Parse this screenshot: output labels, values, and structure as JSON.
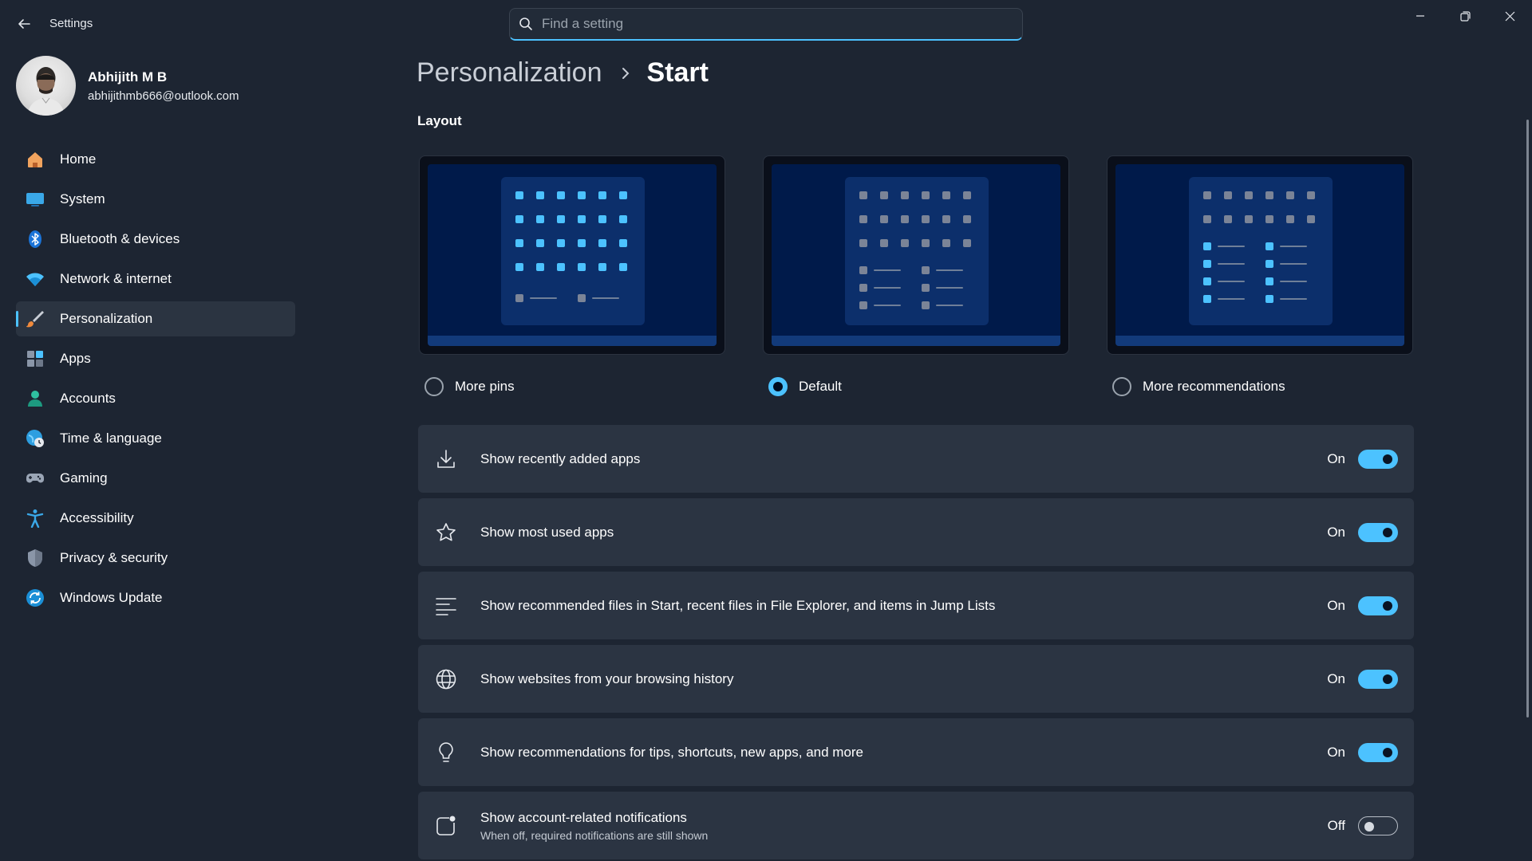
{
  "app": {
    "title": "Settings"
  },
  "search": {
    "placeholder": "Find a setting"
  },
  "profile": {
    "name": "Abhijith M B",
    "email": "abhijithmb666@outlook.com"
  },
  "sidebar": {
    "items": [
      {
        "label": "Home",
        "icon": "home-icon"
      },
      {
        "label": "System",
        "icon": "system-icon"
      },
      {
        "label": "Bluetooth & devices",
        "icon": "bluetooth-icon"
      },
      {
        "label": "Network & internet",
        "icon": "wifi-icon"
      },
      {
        "label": "Personalization",
        "icon": "brush-icon",
        "active": true
      },
      {
        "label": "Apps",
        "icon": "apps-icon"
      },
      {
        "label": "Accounts",
        "icon": "person-icon"
      },
      {
        "label": "Time & language",
        "icon": "globe-clock-icon"
      },
      {
        "label": "Gaming",
        "icon": "gamepad-icon"
      },
      {
        "label": "Accessibility",
        "icon": "accessibility-icon"
      },
      {
        "label": "Privacy & security",
        "icon": "shield-icon"
      },
      {
        "label": "Windows Update",
        "icon": "update-icon"
      }
    ]
  },
  "breadcrumb": {
    "parent": "Personalization",
    "current": "Start"
  },
  "layout": {
    "title": "Layout",
    "options": [
      {
        "label": "More pins",
        "selected": false
      },
      {
        "label": "Default",
        "selected": true
      },
      {
        "label": "More recommendations",
        "selected": false
      }
    ]
  },
  "settings": [
    {
      "title": "Show recently added apps",
      "state": "On",
      "on": true,
      "icon": "download-icon"
    },
    {
      "title": "Show most used apps",
      "state": "On",
      "on": true,
      "icon": "star-icon"
    },
    {
      "title": "Show recommended files in Start, recent files in File Explorer, and items in Jump Lists",
      "state": "On",
      "on": true,
      "icon": "list-icon"
    },
    {
      "title": "Show websites from your browsing history",
      "state": "On",
      "on": true,
      "icon": "globe-icon"
    },
    {
      "title": "Show recommendations for tips, shortcuts, new apps, and more",
      "state": "On",
      "on": true,
      "icon": "lightbulb-icon"
    },
    {
      "title": "Show account-related notifications",
      "subtitle": "When off, required notifications are still shown",
      "state": "Off",
      "on": false,
      "icon": "notification-badge-icon"
    }
  ],
  "colors": {
    "accent": "#4cc2ff",
    "background": "#1d2532",
    "card": "#2b3442"
  }
}
